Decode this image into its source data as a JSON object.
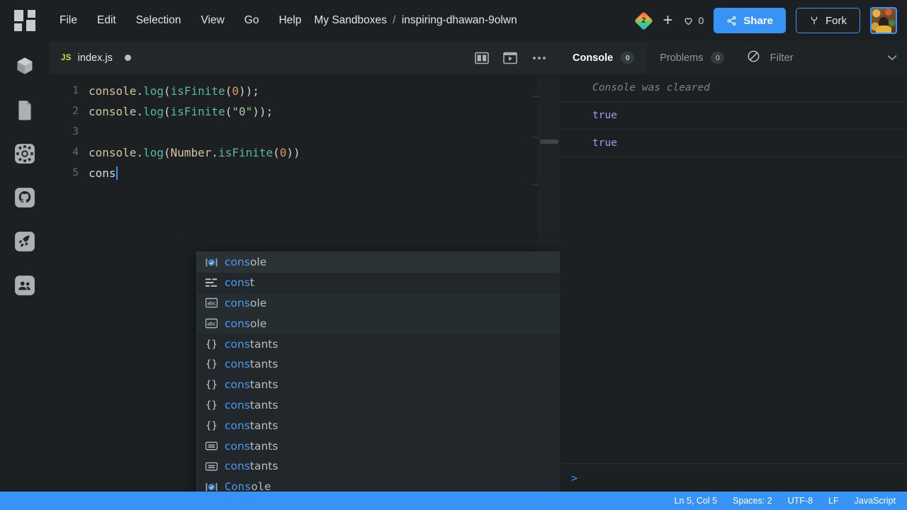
{
  "app": {
    "logo_name": "codesandbox-logo"
  },
  "menubar": {
    "items": [
      {
        "label": "File"
      },
      {
        "label": "Edit"
      },
      {
        "label": "Selection"
      },
      {
        "label": "View"
      },
      {
        "label": "Go"
      },
      {
        "label": "Help"
      }
    ],
    "breadcrumb": {
      "workspace": "My Sandboxes",
      "separator": "/",
      "sandbox": "inspiring-dhawan-9olwn"
    }
  },
  "header_actions": {
    "badge_number": "2",
    "new_label": "+",
    "likes_count": "0",
    "like_icon": "heart-icon",
    "share_label": "Share",
    "share_icon": "share-icon",
    "fork_label": "Fork",
    "fork_icon": "fork-icon",
    "avatar_name": "user-avatar",
    "accent_color": "#3793f5"
  },
  "sidebar": {
    "items": [
      {
        "name": "dependencies",
        "icon": "cube-icon"
      },
      {
        "name": "files",
        "icon": "file-icon"
      },
      {
        "name": "settings",
        "icon": "gear-icon"
      },
      {
        "name": "github",
        "icon": "github-icon"
      },
      {
        "name": "deployment",
        "icon": "rocket-icon"
      },
      {
        "name": "live-collaboration",
        "icon": "people-icon"
      }
    ]
  },
  "editor": {
    "tab": {
      "filetype": "JS",
      "filename": "index.js",
      "unsaved": true
    },
    "actions": [
      {
        "name": "split-editor",
        "icon": "split-editor-icon"
      },
      {
        "name": "open-preview",
        "icon": "preview-play-icon"
      },
      {
        "name": "more-options",
        "icon": "ellipsis-icon"
      }
    ],
    "lines": [
      {
        "number": "1",
        "tokens": [
          {
            "t": "console",
            "c": "t-obj"
          },
          {
            "t": ".",
            "c": "t-punc"
          },
          {
            "t": "log",
            "c": "t-fn"
          },
          {
            "t": "(",
            "c": "t-punc"
          },
          {
            "t": "isFinite",
            "c": "t-fn"
          },
          {
            "t": "(",
            "c": "t-punc"
          },
          {
            "t": "0",
            "c": "t-num"
          },
          {
            "t": "));",
            "c": "t-punc"
          }
        ]
      },
      {
        "number": "2",
        "tokens": [
          {
            "t": "console",
            "c": "t-obj"
          },
          {
            "t": ".",
            "c": "t-punc"
          },
          {
            "t": "log",
            "c": "t-fn"
          },
          {
            "t": "(",
            "c": "t-punc"
          },
          {
            "t": "isFinite",
            "c": "t-fn"
          },
          {
            "t": "(",
            "c": "t-punc"
          },
          {
            "t": "\"0\"",
            "c": "t-str"
          },
          {
            "t": "));",
            "c": "t-punc"
          }
        ]
      },
      {
        "number": "3",
        "tokens": []
      },
      {
        "number": "4",
        "tokens": [
          {
            "t": "console",
            "c": "t-obj"
          },
          {
            "t": ".",
            "c": "t-punc"
          },
          {
            "t": "log",
            "c": "t-fn"
          },
          {
            "t": "(",
            "c": "t-punc"
          },
          {
            "t": "Number",
            "c": "t-obj"
          },
          {
            "t": ".",
            "c": "t-punc"
          },
          {
            "t": "isFinite",
            "c": "t-fn"
          },
          {
            "t": "(",
            "c": "t-punc"
          },
          {
            "t": "0",
            "c": "t-num"
          },
          {
            "t": "))",
            "c": "t-punc"
          }
        ]
      },
      {
        "number": "5",
        "tokens": [
          {
            "t": "cons",
            "c": "t-plain"
          }
        ],
        "caret": true
      }
    ]
  },
  "autocomplete": {
    "typed_prefix": "cons",
    "items": [
      {
        "icon": "module-icon",
        "match": "cons",
        "rest": "ole",
        "state": "selected",
        "mono": false
      },
      {
        "icon": "keyword-icon",
        "match": "cons",
        "rest": "t",
        "state": "normal",
        "mono": false
      },
      {
        "icon": "abc-icon",
        "match": "cons",
        "rest": "ole",
        "state": "hover",
        "mono": false
      },
      {
        "icon": "abc-icon",
        "match": "cons",
        "rest": "ole",
        "state": "hover",
        "mono": false
      },
      {
        "icon": "braces-icon",
        "match": "cons",
        "rest": "tants",
        "state": "normal",
        "mono": false
      },
      {
        "icon": "braces-icon",
        "match": "cons",
        "rest": "tants",
        "state": "normal",
        "mono": false
      },
      {
        "icon": "braces-icon",
        "match": "cons",
        "rest": "tants",
        "state": "normal",
        "mono": false
      },
      {
        "icon": "braces-icon",
        "match": "cons",
        "rest": "tants",
        "state": "normal",
        "mono": false
      },
      {
        "icon": "braces-icon",
        "match": "cons",
        "rest": "tants",
        "state": "normal",
        "mono": false
      },
      {
        "icon": "enum-icon",
        "match": "cons",
        "rest": "tants",
        "state": "normal",
        "mono": false
      },
      {
        "icon": "enum-icon",
        "match": "cons",
        "rest": "tants",
        "state": "normal",
        "mono": false
      },
      {
        "icon": "module-icon",
        "match": "Cons",
        "rest": "ole",
        "state": "normal",
        "mono": true
      }
    ]
  },
  "console_panel": {
    "tabs": [
      {
        "label": "Console",
        "badge": "0",
        "active": true
      },
      {
        "label": "Problems",
        "badge": "0",
        "active": false
      }
    ],
    "clear_icon": "clear-console-icon",
    "filter_label": "Filter",
    "chevron_icon": "chevron-down-icon",
    "rows": [
      {
        "text": "Console was cleared",
        "type": "cleared"
      },
      {
        "text": "true",
        "type": "value"
      },
      {
        "text": "true",
        "type": "value"
      }
    ],
    "prompt_symbol": ">"
  },
  "statusbar": {
    "items": [
      {
        "label": "Ln 5, Col 5"
      },
      {
        "label": "Spaces: 2"
      },
      {
        "label": "UTF-8"
      },
      {
        "label": "LF"
      },
      {
        "label": "JavaScript"
      }
    ],
    "background": "#3793f5"
  }
}
